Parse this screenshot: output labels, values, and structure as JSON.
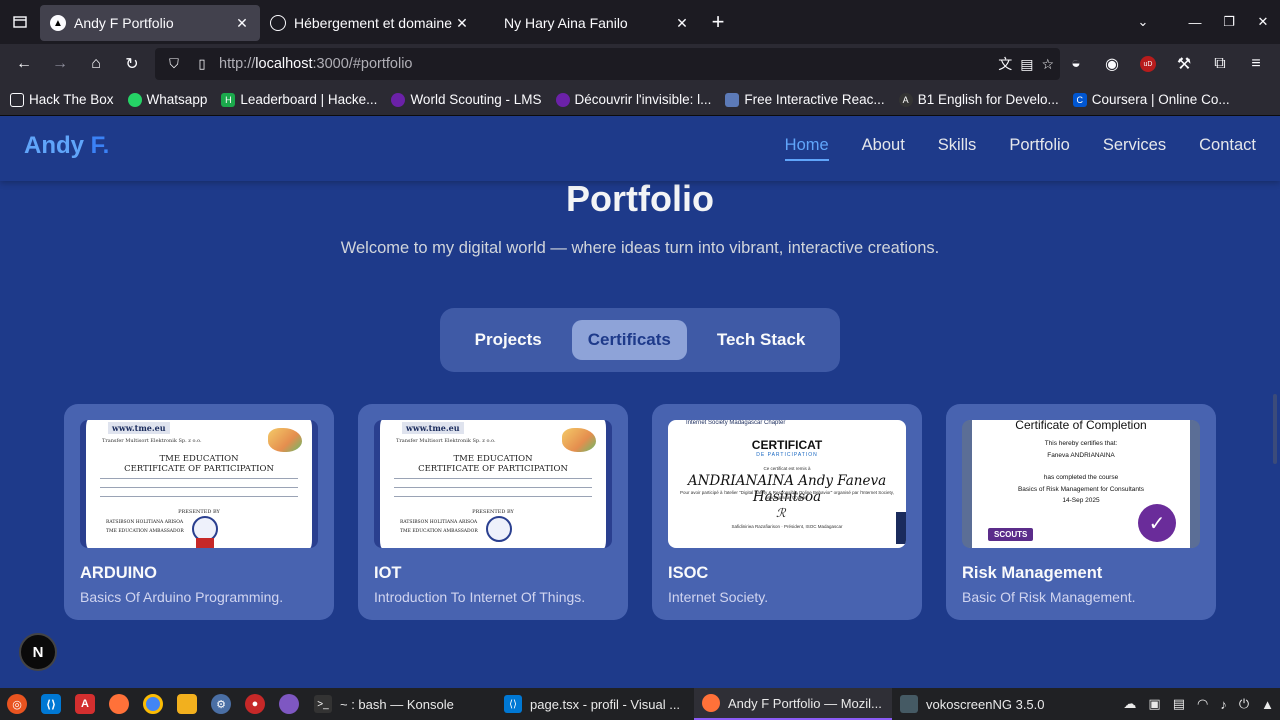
{
  "browser": {
    "tabs": [
      {
        "title": "Andy F Portfolio",
        "active": true
      },
      {
        "title": "Hébergement et domaine",
        "active": false
      },
      {
        "title": "Ny Hary Aina Fanilo",
        "active": false
      }
    ],
    "url_prefix": "http://",
    "url_host": "localhost",
    "url_rest": ":3000/#portfolio",
    "bookmarks": [
      "Hack The Box",
      "Whatsapp",
      "Leaderboard | Hacke...",
      "World Scouting - LMS",
      "Découvrir l'invisible: l...",
      "Free Interactive Reac...",
      "B1 English for Develo...",
      "Coursera | Online Co..."
    ]
  },
  "site": {
    "logo_main": "Andy",
    "logo_accent": "F.",
    "nav": [
      "Home",
      "About",
      "Skills",
      "Portfolio",
      "Services",
      "Contact"
    ],
    "active_nav": "Home",
    "section_title": "Portfolio",
    "section_subtitle": "Welcome to my digital world — where ideas turn into vibrant, interactive creations.",
    "switcher": [
      "Projects",
      "Certificats",
      "Tech Stack"
    ],
    "active_switch": "Certificats",
    "cards": [
      {
        "title": "ARDUINO",
        "desc": "Basics Of Arduino Programming."
      },
      {
        "title": "IOT",
        "desc": "Introduction To Internet Of Things."
      },
      {
        "title": "ISOC",
        "desc": "Internet Society."
      },
      {
        "title": "Risk Management",
        "desc": "Basic Of Risk Management."
      }
    ],
    "cert_thumbs": {
      "tme_url": "www.tme.eu",
      "tme_org": "Transfer Multisort Elektronik Sp. z o.o.",
      "tme_h1": "TME EDUCATION",
      "tme_h2": "CERTIFICATE OF PARTICIPATION",
      "tme_presented": "PRESENTED BY",
      "tme_signer": "RATSIBSON HOLITIANA ARISOA",
      "tme_ambassador": "TME EDUCATION AMBASSADOR",
      "isoc_org": "Internet Society Madagascar Chapter",
      "isoc_h1": "CERTIFICAT",
      "isoc_h2": "DE PARTICIPATION",
      "isoc_to": "Ce certificat est remis à",
      "isoc_name": "ANDRIANAINA Andy Faneva Hasintsoa",
      "isoc_line": "Pour avoir participé à l'atelier \"Digital Safety & Responsible Online Behavior\" organisé par l'Internet Society, Madagascar Chapter",
      "isoc_pres": "Safidiniriна Razafiarison · Président, ISOC Madagascar",
      "risk_h1": "Certificate of Completion",
      "risk_l1": "This hereby certifies that:",
      "risk_l2": "Faneva ANDRIANAINA",
      "risk_l3": "has completed the course",
      "risk_l4": "Basics of Risk Management for Consultants",
      "risk_l5": "14-Sep 2025",
      "risk_badge": "SCOUTS"
    },
    "nextjs_badge": "N"
  },
  "taskbar": {
    "tasks": [
      {
        "label": "~ : bash — Konsole",
        "active": false
      },
      {
        "label": "page.tsx - profil - Visual ...",
        "active": false
      },
      {
        "label": "Andy F Portfolio — Mozil...",
        "active": true
      },
      {
        "label": "vokoscreenNG 3.5.0",
        "active": false
      }
    ]
  }
}
